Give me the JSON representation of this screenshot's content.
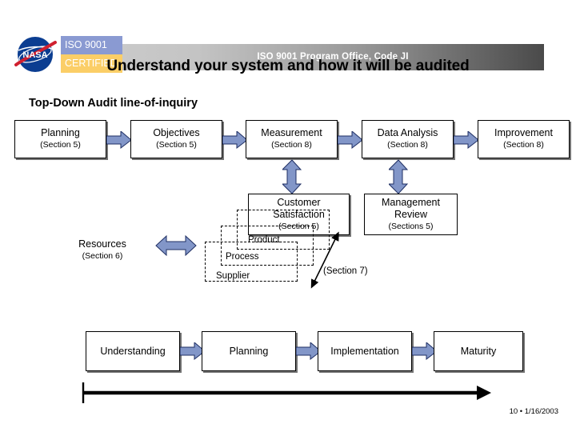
{
  "header": {
    "office_text": "ISO 9001 Program Office, Code JI",
    "badge": {
      "logo_name": "nasa-meatball-logo",
      "line1": "ISO 9001",
      "line2": "CERTIFIED",
      "line1_color": "#8a9ad2",
      "line2_color": "#fbce67"
    }
  },
  "title": "Understand your system and how it will be audited",
  "subtitle": "Top-Down Audit line-of-inquiry",
  "colors": {
    "arrow_fill": "#8296c8",
    "arrow_stroke": "#1f2f63",
    "box_border": "#000000",
    "page_background": "#ffffff"
  },
  "top_flow": {
    "boxes": [
      {
        "label": "Planning",
        "section": "(Section 5)"
      },
      {
        "label": "Objectives",
        "section": "(Section 5)"
      },
      {
        "label": "Measurement",
        "section": "(Section 8)"
      },
      {
        "label": "Data Analysis",
        "section": "(Section 8)"
      },
      {
        "label": "Improvement",
        "section": "(Section 8)"
      }
    ]
  },
  "second_row": {
    "customer": {
      "line1": "Customer",
      "line2": "Satisfaction",
      "section": "(Section 5)"
    },
    "management": {
      "line1": "Management",
      "line2": "Review",
      "section": "(Sections 5)"
    }
  },
  "resources": {
    "label": "Resources",
    "section": "(Section 6)"
  },
  "dashed_stack": {
    "items": [
      {
        "label": "Product"
      },
      {
        "label": "Process"
      },
      {
        "label": "Supplier"
      }
    ],
    "diagonal_arrow_label": "(Section 7)"
  },
  "maturity_flow": {
    "boxes": [
      {
        "label": "Understanding"
      },
      {
        "label": "Planning"
      },
      {
        "label": "Implementation"
      },
      {
        "label": "Maturity"
      }
    ]
  },
  "footer": {
    "text": "10 •  1/16/2003"
  }
}
